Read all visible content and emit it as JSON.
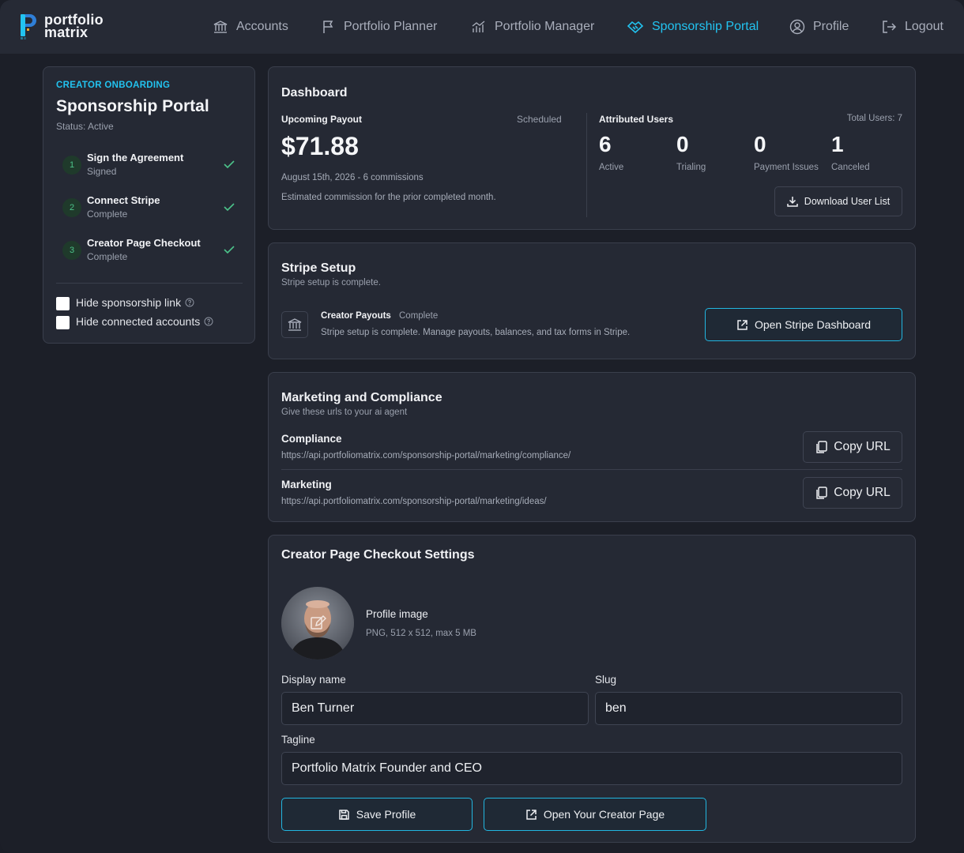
{
  "brand": {
    "line1": "portfolio",
    "line2": "matrix"
  },
  "nav": {
    "accounts": "Accounts",
    "planner": "Portfolio Planner",
    "manager": "Portfolio Manager",
    "sponsorship": "Sponsorship Portal",
    "profile": "Profile",
    "logout": "Logout"
  },
  "onboarding": {
    "eyebrow": "CREATOR ONBOARDING",
    "title": "Sponsorship Portal",
    "status": "Status: Active",
    "steps": [
      {
        "num": "1",
        "title": "Sign the Agreement",
        "status": "Signed"
      },
      {
        "num": "2",
        "title": "Connect Stripe",
        "status": "Complete"
      },
      {
        "num": "3",
        "title": "Creator Page Checkout",
        "status": "Complete"
      }
    ],
    "hide_link": "Hide sponsorship link",
    "hide_accounts": "Hide connected accounts"
  },
  "dashboard": {
    "title": "Dashboard",
    "payout_label": "Upcoming Payout",
    "payout_state": "Scheduled",
    "payout_amount": "$71.88",
    "payout_date": "August 15th, 2026 - 6 commissions",
    "payout_note": "Estimated commission for the prior completed month.",
    "users_label": "Attributed Users",
    "total_users": "Total Users: 7",
    "stats": [
      {
        "value": "6",
        "label": "Active"
      },
      {
        "value": "0",
        "label": "Trialing"
      },
      {
        "value": "0",
        "label": "Payment Issues"
      },
      {
        "value": "1",
        "label": "Canceled"
      }
    ],
    "download_label": "Download User List"
  },
  "stripe": {
    "title": "Stripe Setup",
    "subtitle": "Stripe setup is complete.",
    "payouts_label": "Creator Payouts",
    "payouts_status": "Complete",
    "payouts_desc": "Stripe setup is complete. Manage payouts, balances, and tax forms in Stripe.",
    "open_label": "Open Stripe Dashboard"
  },
  "marketing": {
    "title": "Marketing and Compliance",
    "subtitle": "Give these urls to your ai agent",
    "compliance_label": "Compliance",
    "compliance_url": "https://api.portfoliomatrix.com/sponsorship-portal/marketing/compliance/",
    "marketing_label": "Marketing",
    "marketing_url": "https://api.portfoliomatrix.com/sponsorship-portal/marketing/ideas/",
    "copy_label": "Copy URL"
  },
  "checkout": {
    "title": "Creator Page Checkout Settings",
    "image_label": "Profile image",
    "image_hint": "PNG, 512 x 512, max 5 MB",
    "display_name_label": "Display name",
    "display_name": "Ben Turner",
    "slug_label": "Slug",
    "slug": "ben",
    "tagline_label": "Tagline",
    "tagline": "Portfolio Matrix Founder and CEO",
    "save_label": "Save Profile",
    "open_label": "Open Your Creator Page"
  },
  "colors": {
    "accent": "#22c3f0",
    "success": "#4cc38a",
    "bg": "#1c1f28",
    "card": "#252934"
  }
}
